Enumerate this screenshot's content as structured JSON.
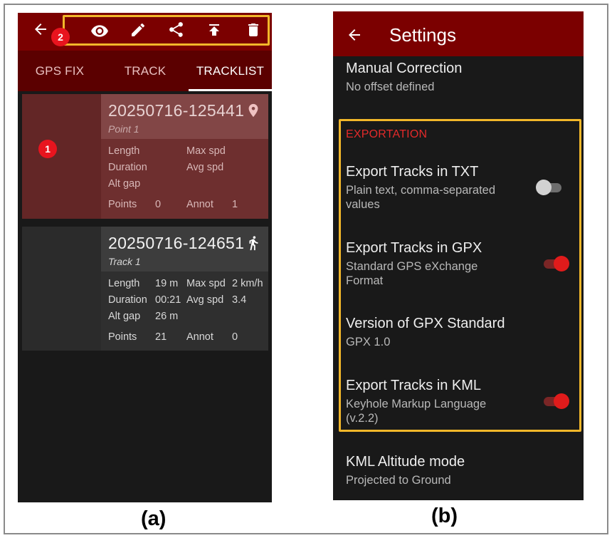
{
  "panel_a": {
    "tabs": [
      {
        "label": "GPS FIX"
      },
      {
        "label": "TRACK"
      },
      {
        "label": "TRACKLIST"
      }
    ],
    "toolbar_icons": [
      "back-arrow-icon",
      "eye-icon",
      "pencil-icon",
      "share-icon",
      "upload-icon",
      "trash-icon"
    ],
    "badges": {
      "one": "1",
      "two": "2"
    },
    "cards": [
      {
        "title": "20250716-125441",
        "subtitle": "Point 1",
        "icon": "map-pin-icon",
        "stats": {
          "length_label": "Length",
          "length_value": "",
          "duration_label": "Duration",
          "duration_value": "",
          "altgap_label": "Alt gap",
          "altgap_value": "",
          "maxspd_label": "Max spd",
          "maxspd_value": "",
          "avgspd_label": "Avg spd",
          "avgspd_value": "",
          "points_label": "Points",
          "points_value": "0",
          "annot_label": "Annot",
          "annot_value": "1"
        }
      },
      {
        "title": "20250716-124651",
        "subtitle": "Track 1",
        "icon": "walking-person-icon",
        "stats": {
          "length_label": "Length",
          "length_value": "19 m",
          "duration_label": "Duration",
          "duration_value": "00:21",
          "altgap_label": "Alt gap",
          "altgap_value": "26 m",
          "maxspd_label": "Max spd",
          "maxspd_value": "2 km/h",
          "avgspd_label": "Avg spd",
          "avgspd_value": "3.4",
          "points_label": "Points",
          "points_value": "21",
          "annot_label": "Annot",
          "annot_value": "0"
        }
      }
    ],
    "caption": "(a)"
  },
  "panel_b": {
    "title": "Settings",
    "manual_correction": {
      "title": "Manual Correction",
      "summary": "No offset defined"
    },
    "section_header": "EXPORTATION",
    "export_txt": {
      "title": "Export Tracks in TXT",
      "summary": "Plain text, comma-separated values",
      "enabled": false
    },
    "export_gpx": {
      "title": "Export Tracks in GPX",
      "summary": "Standard GPS eXchange Format",
      "enabled": true
    },
    "gpx_version": {
      "title": "Version of GPX Standard",
      "summary": "GPX 1.0"
    },
    "export_kml": {
      "title": "Export Tracks in KML",
      "summary": "Keyhole Markup Language (v.2.2)",
      "enabled": true
    },
    "kml_altitude": {
      "title": "KML Altitude mode",
      "summary": "Projected to Ground"
    },
    "caption": "(b)"
  },
  "colors": {
    "toolbar_red": "#7b0000",
    "tab_bar_red": "#5b0000",
    "highlight_yellow": "#f2b72a",
    "badge_red": "#e8141e",
    "accent_red": "#e01b1b",
    "background_dark": "#191919"
  }
}
